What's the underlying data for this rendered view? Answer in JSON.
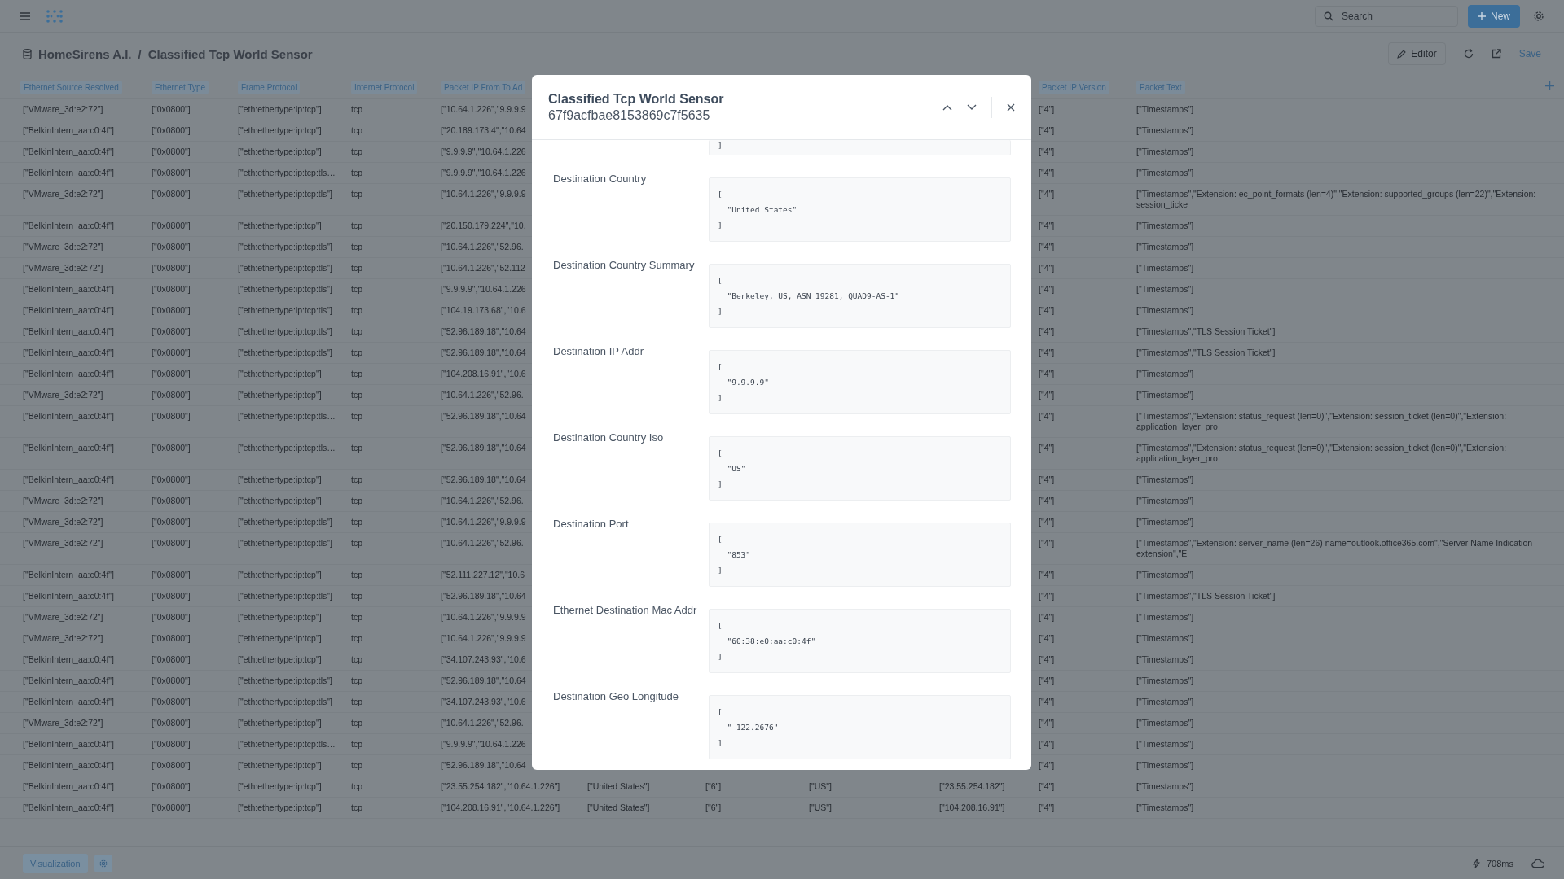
{
  "topbar": {
    "search": {
      "placeholder": "Search"
    },
    "new_button": "New"
  },
  "breadcrumb": {
    "workspace": "HomeSirens A.I.",
    "separator": "/",
    "page": "Classified Tcp World Sensor",
    "editor_button": "Editor",
    "save_link": "Save"
  },
  "table": {
    "columns": [
      "Ethernet Source Resolved",
      "Ethernet Type",
      "Frame Protocol",
      "Internet Protocol",
      "Packet IP From To Ad",
      "Packet IP Version",
      "Packet Text"
    ],
    "rows": [
      {
        "cells": [
          "[\"VMware_3d:e2:72\"]",
          "[\"0x0800\"]",
          "[\"eth:ethertype:ip:tcp\"]",
          "tcp",
          "[\"10.64.1.226\",\"9.9.9.9",
          "[\"4\"]",
          "[\"Timestamps\"]"
        ]
      },
      {
        "cells": [
          "[\"BelkinIntern_aa:c0:4f\"]",
          "[\"0x0800\"]",
          "[\"eth:ethertype:ip:tcp\"]",
          "tcp",
          "[\"20.189.173.4\",\"10.64",
          "[\"4\"]",
          "[\"Timestamps\"]"
        ]
      },
      {
        "cells": [
          "[\"BelkinIntern_aa:c0:4f\"]",
          "[\"0x0800\"]",
          "[\"eth:ethertype:ip:tcp\"]",
          "tcp",
          "[\"9.9.9.9\",\"10.64.1.226",
          "[\"4\"]",
          "[\"Timestamps\"]"
        ]
      },
      {
        "cells": [
          "[\"BelkinIntern_aa:c0:4f\"]",
          "[\"0x0800\"]",
          "[\"eth:ethertype:ip:tcp:tls…",
          "tcp",
          "[\"9.9.9.9\",\"10.64.1.226",
          "[\"4\"]",
          "[\"Timestamps\"]"
        ]
      },
      {
        "cells": [
          "[\"VMware_3d:e2:72\"]",
          "[\"0x0800\"]",
          "[\"eth:ethertype:ip:tcp:tls\"]",
          "tcp",
          "[\"10.64.1.226\",\"9.9.9.9",
          "[\"4\"]",
          "[\"Timestamps\",\"Extension: ec_point_formats (len=4)\",\"Extension: supported_groups (len=22)\",\"Extension: session_ticke"
        ]
      },
      {
        "cells": [
          "[\"BelkinIntern_aa:c0:4f\"]",
          "[\"0x0800\"]",
          "[\"eth:ethertype:ip:tcp\"]",
          "tcp",
          "[\"20.150.179.224\",\"10.",
          "[\"4\"]",
          "[\"Timestamps\"]"
        ]
      },
      {
        "cells": [
          "[\"VMware_3d:e2:72\"]",
          "[\"0x0800\"]",
          "[\"eth:ethertype:ip:tcp:tls\"]",
          "tcp",
          "[\"10.64.1.226\",\"52.96.",
          "[\"4\"]",
          "[\"Timestamps\"]"
        ]
      },
      {
        "cells": [
          "[\"VMware_3d:e2:72\"]",
          "[\"0x0800\"]",
          "[\"eth:ethertype:ip:tcp:tls\"]",
          "tcp",
          "[\"10.64.1.226\",\"52.112",
          "[\"4\"]",
          "[\"Timestamps\"]"
        ]
      },
      {
        "cells": [
          "[\"BelkinIntern_aa:c0:4f\"]",
          "[\"0x0800\"]",
          "[\"eth:ethertype:ip:tcp:tls\"]",
          "tcp",
          "[\"9.9.9.9\",\"10.64.1.226",
          "[\"4\"]",
          "[\"Timestamps\"]"
        ]
      },
      {
        "cells": [
          "[\"BelkinIntern_aa:c0:4f\"]",
          "[\"0x0800\"]",
          "[\"eth:ethertype:ip:tcp:tls\"]",
          "tcp",
          "[\"104.19.173.68\",\"10.6",
          "[\"4\"]",
          "[\"Timestamps\"]"
        ]
      },
      {
        "cells": [
          "[\"BelkinIntern_aa:c0:4f\"]",
          "[\"0x0800\"]",
          "[\"eth:ethertype:ip:tcp:tls\"]",
          "tcp",
          "[\"52.96.189.18\",\"10.64",
          "[\"4\"]",
          "[\"Timestamps\",\"TLS Session Ticket\"]"
        ]
      },
      {
        "cells": [
          "[\"BelkinIntern_aa:c0:4f\"]",
          "[\"0x0800\"]",
          "[\"eth:ethertype:ip:tcp:tls\"]",
          "tcp",
          "[\"52.96.189.18\",\"10.64",
          "[\"4\"]",
          "[\"Timestamps\",\"TLS Session Ticket\"]"
        ]
      },
      {
        "cells": [
          "[\"BelkinIntern_aa:c0:4f\"]",
          "[\"0x0800\"]",
          "[\"eth:ethertype:ip:tcp\"]",
          "tcp",
          "[\"104.208.16.91\",\"10.6",
          "[\"4\"]",
          "[\"Timestamps\"]"
        ]
      },
      {
        "cells": [
          "[\"VMware_3d:e2:72\"]",
          "[\"0x0800\"]",
          "[\"eth:ethertype:ip:tcp\"]",
          "tcp",
          "[\"10.64.1.226\",\"52.96.",
          "[\"4\"]",
          "[\"Timestamps\"]"
        ]
      },
      {
        "cells": [
          "[\"BelkinIntern_aa:c0:4f\"]",
          "[\"0x0800\"]",
          "[\"eth:ethertype:ip:tcp:tls…",
          "tcp",
          "[\"52.96.189.18\",\"10.64",
          "[\"4\"]",
          "[\"Timestamps\",\"Extension: status_request (len=0)\",\"Extension: session_ticket (len=0)\",\"Extension: application_layer_pro"
        ]
      },
      {
        "cells": [
          "[\"BelkinIntern_aa:c0:4f\"]",
          "[\"0x0800\"]",
          "[\"eth:ethertype:ip:tcp:tls…",
          "tcp",
          "[\"52.96.189.18\",\"10.64",
          "[\"4\"]",
          "[\"Timestamps\",\"Extension: status_request (len=0)\",\"Extension: session_ticket (len=0)\",\"Extension: application_layer_pro"
        ]
      },
      {
        "cells": [
          "[\"BelkinIntern_aa:c0:4f\"]",
          "[\"0x0800\"]",
          "[\"eth:ethertype:ip:tcp\"]",
          "tcp",
          "[\"52.96.189.18\",\"10.64",
          "[\"4\"]",
          "[\"Timestamps\"]"
        ]
      },
      {
        "cells": [
          "[\"VMware_3d:e2:72\"]",
          "[\"0x0800\"]",
          "[\"eth:ethertype:ip:tcp\"]",
          "tcp",
          "[\"10.64.1.226\",\"52.96.",
          "[\"4\"]",
          "[\"Timestamps\"]"
        ]
      },
      {
        "cells": [
          "[\"VMware_3d:e2:72\"]",
          "[\"0x0800\"]",
          "[\"eth:ethertype:ip:tcp:tls\"]",
          "tcp",
          "[\"10.64.1.226\",\"9.9.9.9",
          "[\"4\"]",
          "[\"Timestamps\"]"
        ]
      },
      {
        "cells": [
          "[\"VMware_3d:e2:72\"]",
          "[\"0x0800\"]",
          "[\"eth:ethertype:ip:tcp:tls\"]",
          "tcp",
          "[\"10.64.1.226\",\"52.96.",
          "[\"4\"]",
          "[\"Timestamps\",\"Extension: server_name (len=26) name=outlook.office365.com\",\"Server Name Indication extension\",\"E"
        ]
      },
      {
        "cells": [
          "[\"BelkinIntern_aa:c0:4f\"]",
          "[\"0x0800\"]",
          "[\"eth:ethertype:ip:tcp\"]",
          "tcp",
          "[\"52.111.227.12\",\"10.6",
          "[\"4\"]",
          "[\"Timestamps\"]"
        ]
      },
      {
        "cells": [
          "[\"BelkinIntern_aa:c0:4f\"]",
          "[\"0x0800\"]",
          "[\"eth:ethertype:ip:tcp:tls\"]",
          "tcp",
          "[\"52.96.189.18\",\"10.64",
          "[\"4\"]",
          "[\"Timestamps\",\"TLS Session Ticket\"]"
        ]
      },
      {
        "cells": [
          "[\"VMware_3d:e2:72\"]",
          "[\"0x0800\"]",
          "[\"eth:ethertype:ip:tcp\"]",
          "tcp",
          "[\"10.64.1.226\",\"9.9.9.9",
          "[\"4\"]",
          "[\"Timestamps\"]"
        ]
      },
      {
        "cells": [
          "[\"VMware_3d:e2:72\"]",
          "[\"0x0800\"]",
          "[\"eth:ethertype:ip:tcp\"]",
          "tcp",
          "[\"10.64.1.226\",\"9.9.9.9",
          "[\"4\"]",
          "[\"Timestamps\"]"
        ]
      },
      {
        "cells": [
          "[\"BelkinIntern_aa:c0:4f\"]",
          "[\"0x0800\"]",
          "[\"eth:ethertype:ip:tcp\"]",
          "tcp",
          "[\"34.107.243.93\",\"10.6",
          "[\"4\"]",
          "[\"Timestamps\"]"
        ]
      },
      {
        "cells": [
          "[\"BelkinIntern_aa:c0:4f\"]",
          "[\"0x0800\"]",
          "[\"eth:ethertype:ip:tcp:tls\"]",
          "tcp",
          "[\"52.96.189.18\",\"10.64",
          "[\"4\"]",
          "[\"Timestamps\"]"
        ]
      },
      {
        "cells": [
          "[\"BelkinIntern_aa:c0:4f\"]",
          "[\"0x0800\"]",
          "[\"eth:ethertype:ip:tcp:tls\"]",
          "tcp",
          "[\"34.107.243.93\",\"10.6",
          "[\"4\"]",
          "[\"Timestamps\"]"
        ]
      },
      {
        "cells": [
          "[\"VMware_3d:e2:72\"]",
          "[\"0x0800\"]",
          "[\"eth:ethertype:ip:tcp\"]",
          "tcp",
          "[\"10.64.1.226\",\"52.96.",
          "[\"4\"]",
          "[\"Timestamps\"]"
        ]
      },
      {
        "cells": [
          "[\"BelkinIntern_aa:c0:4f\"]",
          "[\"0x0800\"]",
          "[\"eth:ethertype:ip:tcp:tls…",
          "tcp",
          "[\"9.9.9.9\",\"10.64.1.226",
          "[\"4\"]",
          "[\"Timestamps\"]"
        ]
      },
      {
        "cells": [
          "[\"BelkinIntern_aa:c0:4f\"]",
          "[\"0x0800\"]",
          "[\"eth:ethertype:ip:tcp\"]",
          "tcp",
          "[\"52.96.189.18\",\"10.64",
          "[\"4\"]",
          "[\"Timestamps\"]"
        ]
      },
      {
        "cells": [
          "[\"BelkinIntern_aa:c0:4f\"]",
          "[\"0x0800\"]",
          "[\"eth:ethertype:ip:tcp\"]",
          "tcp",
          "[\"23.55.254.182\",\"10.64.1.226\"]",
          "[\"United States\"]",
          "[\"6\"]",
          "[\"US\"]",
          "[\"23.55.254.182\"]",
          "[\"4\"]",
          "[\"Timestamps\"]"
        ]
      },
      {
        "cells": [
          "[\"BelkinIntern_aa:c0:4f\"]",
          "[\"0x0800\"]",
          "[\"eth:ethertype:ip:tcp\"]",
          "tcp",
          "[\"104.208.16.91\",\"10.64.1.226\"]",
          "[\"United States\"]",
          "[\"6\"]",
          "[\"US\"]",
          "[\"104.208.16.91\"]",
          "[\"4\"]",
          "[\"Timestamps\"]"
        ]
      }
    ]
  },
  "modal": {
    "title": "Classified Tcp World Sensor",
    "subtitle": "67f9acfbae8153869c7f5635",
    "fields": [
      {
        "value": "]"
      },
      {
        "label": "Destination Country",
        "value": "[\n  \"United States\"\n]"
      },
      {
        "label": "Destination Country Summary",
        "value": "[\n  \"Berkeley, US, ASN 19281, QUAD9-AS-1\"\n]"
      },
      {
        "label": "Destination IP Addr",
        "value": "[\n  \"9.9.9.9\"\n]"
      },
      {
        "label": "Destination Country Iso",
        "value": "[\n  \"US\"\n]"
      },
      {
        "label": "Destination Port",
        "value": "[\n  \"853\"\n]"
      },
      {
        "label": "Ethernet Destination Mac Addr",
        "value": "[\n  \"60:38:e0:aa:c0:4f\"\n]"
      },
      {
        "label": "Destination Geo Longitude",
        "value": "[\n  \"-122.2676\"\n]"
      }
    ]
  },
  "bottombar": {
    "visualization_button": "Visualization",
    "timing": "708ms"
  }
}
